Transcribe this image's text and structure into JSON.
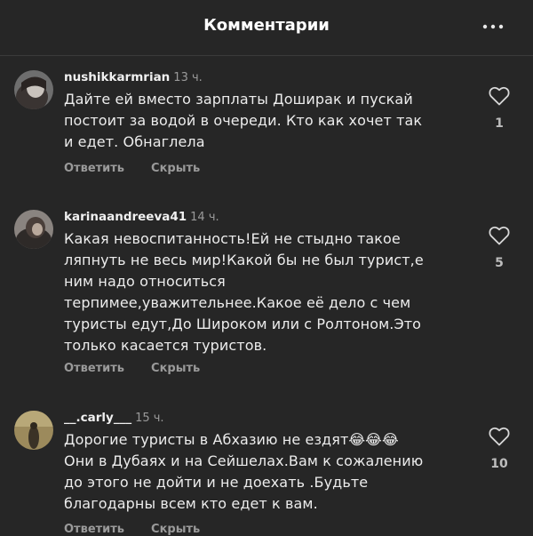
{
  "header": {
    "title": "Комментарии",
    "more_icon": "more-horizontal-icon"
  },
  "comments": [
    {
      "username": "nushikkarmrian",
      "time": "13 ч.",
      "text": "Дайте ей вместо зарплаты Доширак и пускай\nпостоит за водой в очереди. Кто как хочет так\nи едет. Обнаглела",
      "reply_label": "Ответить",
      "hide_label": "Скрыть",
      "likes": "1",
      "like_icon": "heart-outline-icon"
    },
    {
      "username": "karinaandreeva41",
      "time": "14 ч.",
      "text": "Какая невоспитанность!Ей не стыдно такое\nляпнуть не весь мир!Какой бы не был турист,е\nним надо относиться\nтерпимее,уважительнее.Какое её дело с чем\nтуристы едут,До Широком или с Ролтоном.Это\nтолько касается туристов.",
      "reply_label": "Ответить",
      "hide_label": "Скрыть",
      "likes": "5",
      "like_icon": "heart-outline-icon"
    },
    {
      "username": "__.carly___",
      "time": "15 ч.",
      "text": "Дорогие туристы в Абхазию не ездят😂😂😂\nОни в Дубаях и на Сейшелах.Вам к сожалению\nдо этого не дойти и не доехать .Будьте\nблагодарны всем кто едет к вам.",
      "reply_label": "Ответить",
      "hide_label": "Скрыть",
      "likes": "10",
      "like_icon": "heart-outline-icon"
    }
  ]
}
